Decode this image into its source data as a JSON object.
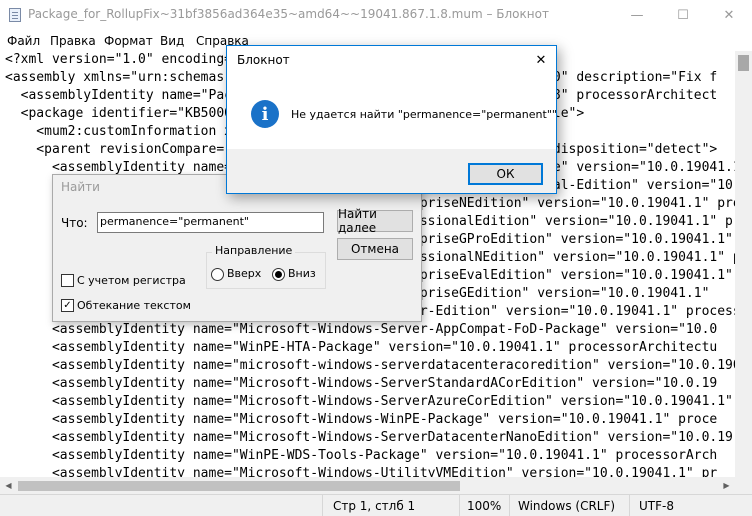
{
  "window": {
    "title": "Package_for_RollupFix~31bf3856ad364e35~amd64~~19041.867.1.8.mum – Блокнот",
    "minimize": "—",
    "maximize": "☐",
    "close": "✕"
  },
  "menu": [
    "Файл",
    "Правка",
    "Формат",
    "Вид",
    "Справка"
  ],
  "editor": {
    "lines": [
      "<?xml version=\"1.0\" encoding=\"utf-8\" standalone=\"yes\"?>",
      "<assembly xmlns=\"urn:schemas-microsoft-com:asm.v3\" manifestVersion=\"1.0\" description=\"Fix f",
      "  <assemblyIdentity name=\"Package_for_RollupFix\" version=\"19041.867.1.8\" processorArchitect",
      "  <package identifier=\"KB5000842\" releaseType=\"Update\" restart=\"possible\">",
      "    <mum2:customInformation xmlns:mum2=\"urn:schemas-microsoft-com:",
      "    <parent revisionCompare=\"greaterThanOrEqual\" integrate=\"separate\" disposition=\"detect\">",
      "      <assemblyIdentity name=\"Microsoft-Windows-Client-Features-Package\" version=\"10.0.19041.1\" process",
      "      <assemblyIdentity name=\"Microsoft-Windows-EditionPack-Professional-Edition\" version=\"10.0.1",
      "      <assemblyIdentity name=\"Microsoft-Windows-EnterpriseNEdition\" version=\"10.0.19041.1\" proces",
      "      <assemblyIdentity name=\"Microsoft-Windows-ProfessionalEdition\" version=\"10.0.19041.1\" pro",
      "      <assemblyIdentity name=\"Microsoft-Windows-EnterpriseGProEdition\" version=\"10.0.19041.1\" proce",
      "      <assemblyIdentity name=\"Microsoft-Windows-ProfessionalNEdition\" version=\"10.0.19041.1\" pro",
      "      <assemblyIdentity name=\"Microsoft-Windows-EnterpriseEvalEdition\" version=\"10.0.19041.1\" pro",
      "      <assemblyIdentity name=\"Microsoft-Windows-EnterpriseGEdition\" version=\"10.0.19041.1\"",
      "      <assemblyIdentity name=\"Microsoft-Windows-Server-Edition\" version=\"10.0.19041.1\" processorArchitectu",
      "      <assemblyIdentity name=\"Microsoft-Windows-Server-AppCompat-FoD-Package\" version=\"10.0",
      "      <assemblyIdentity name=\"WinPE-HTA-Package\" version=\"10.0.19041.1\" processorArchitectu",
      "      <assemblyIdentity name=\"microsoft-windows-serverdatacenteracoredition\" version=\"10.0.1904",
      "      <assemblyIdentity name=\"Microsoft-Windows-ServerStandardACorEdition\" version=\"10.0.19",
      "      <assemblyIdentity name=\"Microsoft-Windows-ServerAzureCorEdition\" version=\"10.0.19041.1\"",
      "      <assemblyIdentity name=\"Microsoft-Windows-WinPE-Package\" version=\"10.0.19041.1\" proce",
      "      <assemblyIdentity name=\"Microsoft-Windows-ServerDatacenterNanoEdition\" version=\"10.0.19",
      "      <assemblyIdentity name=\"WinPE-WDS-Tools-Package\" version=\"10.0.19041.1\" processorArch",
      "      <assemblyIdentity name=\"Microsoft-Windows-UtilityVMEdition\" version=\"10.0.19041.1\" pr"
    ]
  },
  "status": {
    "position": "Стр 1, стлб 1",
    "zoom": "100%",
    "line_endings": "Windows (CRLF)",
    "encoding": "UTF-8"
  },
  "message_box": {
    "title": "Блокнот",
    "close": "✕",
    "icon": "info-icon",
    "icon_glyph": "i",
    "message": "Не удается найти \"permanence=\"permanent\"\"",
    "ok_label": "ОК"
  },
  "find_dialog": {
    "title": "Найти",
    "what_label": "Что:",
    "what_value": "permanence=\"permanent\"",
    "find_next_label": "Найти далее",
    "cancel_label": "Отмена",
    "direction_label": "Направление",
    "up_label": "Вверх",
    "down_label": "Вниз",
    "direction_selected": "down",
    "match_case_label": "С учетом регистра",
    "match_case_checked": false,
    "wrap_label": "Обтекание текстом",
    "wrap_checked": true,
    "checkmark": "✓"
  },
  "colors": {
    "accent": "#0078d7",
    "info_icon": "#1a72c8",
    "dialog_bg": "#f0f0f0"
  }
}
